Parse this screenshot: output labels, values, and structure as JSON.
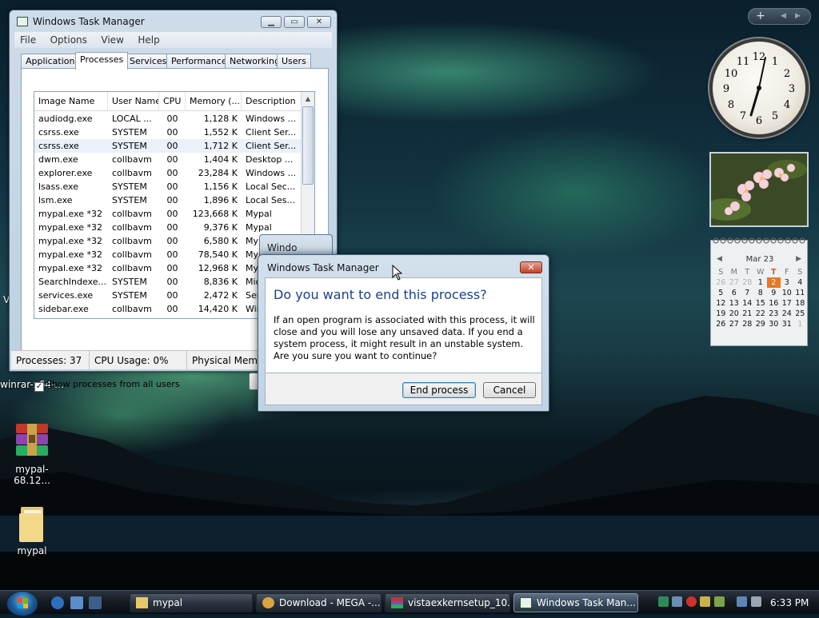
{
  "desktop": {
    "icons": [
      {
        "label": "winrar-x64-..."
      },
      {
        "label": "mypal-68.12..."
      },
      {
        "label": "mypal"
      }
    ],
    "partial_left_label": "V"
  },
  "taskmgr": {
    "title": "Windows Task Manager",
    "menu": [
      "File",
      "Options",
      "View",
      "Help"
    ],
    "tabs": [
      "Applications",
      "Processes",
      "Services",
      "Performance",
      "Networking",
      "Users"
    ],
    "active_tab": "Processes",
    "columns": [
      "Image Name",
      "User Name",
      "CPU",
      "Memory (...",
      "Description"
    ],
    "rows": [
      [
        "audiodg.exe",
        "LOCAL ...",
        "00",
        "1,128 K",
        "Windows ..."
      ],
      [
        "csrss.exe",
        "SYSTEM",
        "00",
        "1,552 K",
        "Client Ser..."
      ],
      [
        "csrss.exe",
        "SYSTEM",
        "00",
        "1,712 K",
        "Client Ser..."
      ],
      [
        "dwm.exe",
        "collbavm",
        "00",
        "1,404 K",
        "Desktop ..."
      ],
      [
        "explorer.exe",
        "collbavm",
        "00",
        "23,284 K",
        "Windows ..."
      ],
      [
        "lsass.exe",
        "SYSTEM",
        "00",
        "1,156 K",
        "Local Sec..."
      ],
      [
        "lsm.exe",
        "SYSTEM",
        "00",
        "1,896 K",
        "Local Ses..."
      ],
      [
        "mypal.exe *32",
        "collbavm",
        "00",
        "123,668 K",
        "Mypal"
      ],
      [
        "mypal.exe *32",
        "collbavm",
        "00",
        "9,376 K",
        "Mypal"
      ],
      [
        "mypal.exe *32",
        "collbavm",
        "00",
        "6,580 K",
        "Mypal"
      ],
      [
        "mypal.exe *32",
        "collbavm",
        "00",
        "78,540 K",
        "Myp"
      ],
      [
        "mypal.exe *32",
        "collbavm",
        "00",
        "12,968 K",
        "Myp"
      ],
      [
        "SearchIndexe...",
        "SYSTEM",
        "00",
        "8,836 K",
        "Mic"
      ],
      [
        "services.exe",
        "SYSTEM",
        "00",
        "2,472 K",
        "Ser"
      ],
      [
        "sidebar.exe",
        "collbavm",
        "00",
        "14,420 K",
        "Win"
      ]
    ],
    "show_all_users": "Show processes from all users",
    "end_button_partial": "En",
    "status": {
      "processes": "Processes: 37",
      "cpu": "CPU Usage: 0%",
      "memory": "Physical Memor"
    }
  },
  "background_dialog": {
    "title_partial": "Windo"
  },
  "dialog": {
    "title": "Windows Task Manager",
    "heading": "Do you want to end this process?",
    "body": "If an open program is associated with this process, it will close and you will lose any unsaved data. If you end a system process, it might result in an unstable system. Are you sure you want to continue?",
    "end_button": "End process",
    "cancel_button": "Cancel"
  },
  "sidebar": {
    "add_glyph": "+",
    "prev_glyph": "◀",
    "next_glyph": "▶",
    "clock": {
      "numerals": [
        "12",
        "1",
        "2",
        "3",
        "4",
        "5",
        "6",
        "7",
        "8",
        "9",
        "10",
        "11"
      ]
    },
    "calendar": {
      "month": "Mar 23",
      "prev": "◀",
      "next": "▶",
      "weekdays": [
        "S",
        "M",
        "T",
        "W",
        "T",
        "F",
        "S"
      ],
      "weeks": [
        [
          "26",
          "27",
          "28",
          "1",
          "2",
          "3",
          "4"
        ],
        [
          "5",
          "6",
          "7",
          "8",
          "9",
          "10",
          "11"
        ],
        [
          "12",
          "13",
          "14",
          "15",
          "16",
          "17",
          "18"
        ],
        [
          "19",
          "20",
          "21",
          "22",
          "23",
          "24",
          "25"
        ],
        [
          "26",
          "27",
          "28",
          "29",
          "30",
          "31",
          "1"
        ]
      ]
    }
  },
  "taskbar": {
    "buttons": [
      {
        "label": "mypal"
      },
      {
        "label": "Download - MEGA -..."
      },
      {
        "label": "vistaexkernsetup_10..."
      },
      {
        "label": "Windows Task Man..."
      }
    ],
    "time": "6:33 PM"
  },
  "colors": {
    "dialog_heading": "#1b3f8d",
    "today_highlight": "#e87722",
    "close_button": "#c2412b"
  }
}
